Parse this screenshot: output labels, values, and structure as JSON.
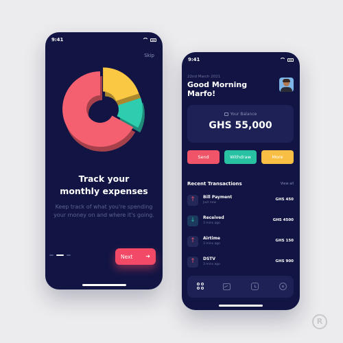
{
  "colors": {
    "background": "#ececee",
    "phone": "#121543",
    "card": "#1d2156",
    "accent_red": "#f05468",
    "accent_teal": "#28c2a3",
    "accent_yellow": "#f9bf45",
    "pie_pink": "#f4606f",
    "pie_yellow": "#fbc844",
    "pie_teal": "#2ecdb0"
  },
  "onboarding": {
    "status_time": "9:41",
    "skip_label": "Skip",
    "title": "Track your monthly expenses",
    "description": "Keep track of what you're spending your money on and where it's going.",
    "page_indicator": {
      "active_index": 1,
      "total": 3
    },
    "next_label": "Next",
    "next_icon": "arrow-right-icon"
  },
  "chart_data": {
    "type": "pie",
    "style": "3d-donut",
    "segments": [
      {
        "color": "#f4606f",
        "share": 0.67
      },
      {
        "color": "#fbc844",
        "share": 0.2
      },
      {
        "color": "#2ecdb0",
        "share": 0.13
      }
    ]
  },
  "wallet": {
    "status_time": "9:41",
    "date": "22nd March 2021",
    "greeting_line1": "Good Morning",
    "greeting_line2": "Marfo!",
    "balance_label": "Your Balance",
    "balance_amount": "GHS 55,000",
    "actions": {
      "send": "Send",
      "withdraw": "Withdraw",
      "more": "More"
    },
    "recent_title": "Recent Transactions",
    "view_all": "View all",
    "transactions": [
      {
        "name": "Bill Payment",
        "time": "Just now",
        "amount": "GHS 450",
        "direction": "up"
      },
      {
        "name": "Received",
        "time": "3 mins ago",
        "amount": "GHS 4500",
        "direction": "down"
      },
      {
        "name": "Airtime",
        "time": "3 mins ago",
        "amount": "GHS 150",
        "direction": "up"
      },
      {
        "name": "DSTV",
        "time": "3 mins ago",
        "amount": "GHS 900",
        "direction": "up"
      }
    ],
    "nav_icons": [
      "grid-icon",
      "chart-icon",
      "clock-icon",
      "settings-icon"
    ]
  },
  "watermark": "R"
}
